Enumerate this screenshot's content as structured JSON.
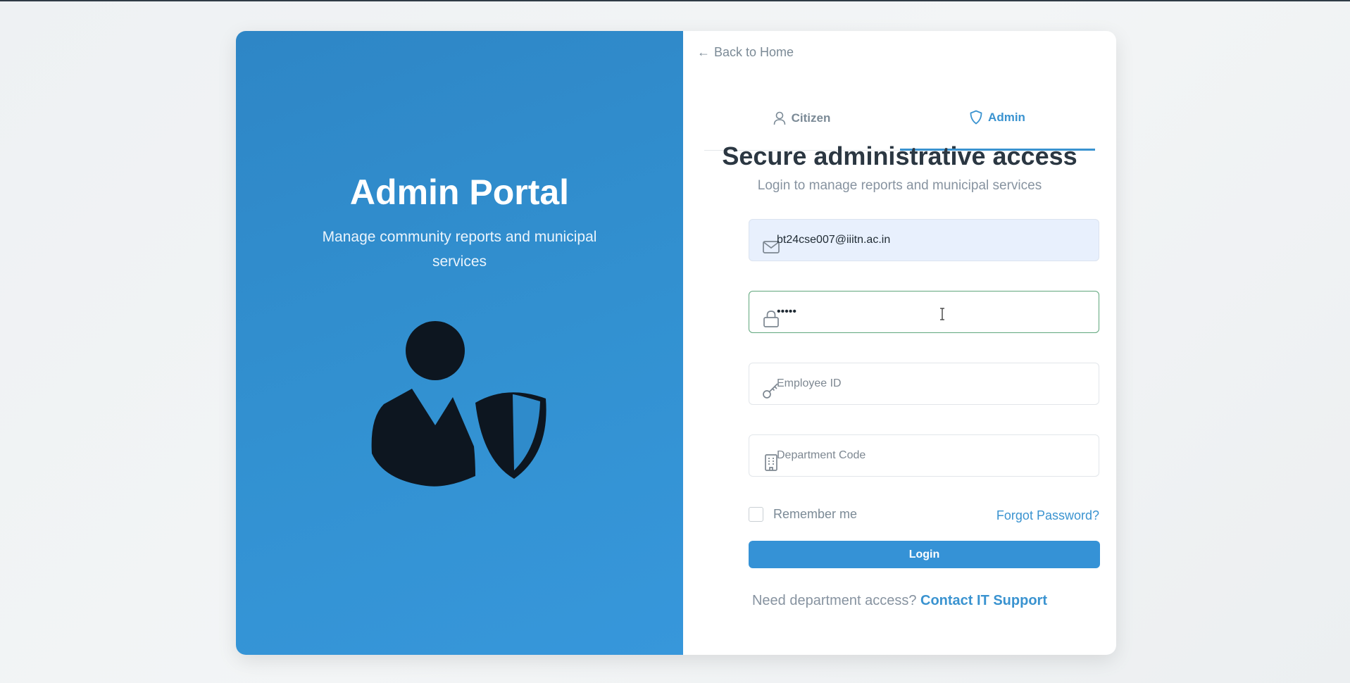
{
  "left_panel": {
    "title": "Admin Portal",
    "subtitle": "Manage community reports and municipal services",
    "illustration_icon": "admin-shield-user-icon"
  },
  "back_link": {
    "label": "Back to Home",
    "icon": "arrow-left-icon"
  },
  "tabs": [
    {
      "label": "Citizen",
      "icon": "user-icon",
      "active": false
    },
    {
      "label": "Admin",
      "icon": "shield-icon",
      "active": true
    }
  ],
  "form": {
    "heading": "Secure administrative access",
    "subheading": "Login to manage reports and municipal services",
    "email": {
      "value": "bt24cse007@iiitn.ac.in",
      "icon": "mail-icon"
    },
    "password": {
      "value": "•••••",
      "icon": "lock-icon"
    },
    "employee_id": {
      "placeholder": "Employee ID",
      "value": "",
      "icon": "key-icon"
    },
    "department_code": {
      "placeholder": "Department Code",
      "value": "",
      "icon": "building-icon"
    },
    "remember_label": "Remember me",
    "forgot_label": "Forgot Password?",
    "login_label": "Login"
  },
  "footer": {
    "text": "Need department access?",
    "link": "Contact IT Support"
  },
  "colors": {
    "accent": "#3592d6",
    "left_panel": "#3291d1",
    "heading": "#2b3742",
    "muted": "#8793a0"
  }
}
